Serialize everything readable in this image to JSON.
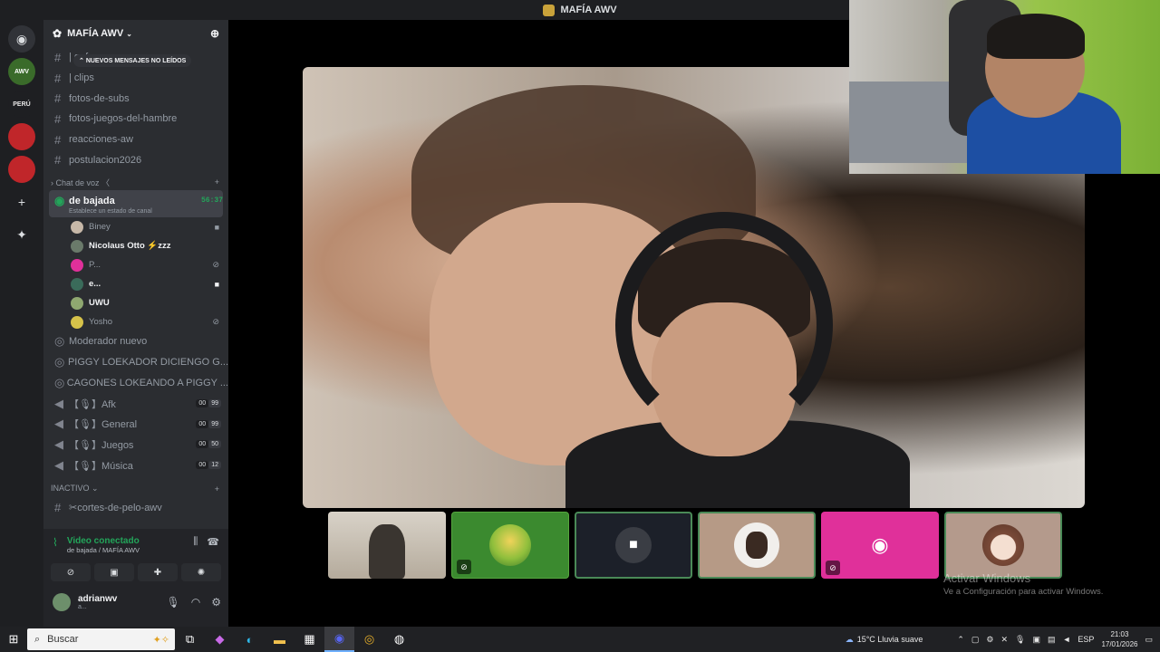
{
  "window": {
    "title": "MAFÍA AWV"
  },
  "rail": {
    "servers": [
      {
        "name": "discord-home",
        "icon": "discord-icon"
      },
      {
        "label": "AWV",
        "color": "#3a6b2a"
      },
      {
        "label": "PERÚ",
        "color": "#1e1f22"
      },
      {
        "label": "",
        "color": "#c0262a"
      },
      {
        "label": "",
        "color": "#c0262a"
      }
    ],
    "add_icon": "plus-icon",
    "explore_icon": "compass-icon"
  },
  "server": {
    "name": "MAFÍA AWV",
    "banner": "NUEVOS MENSAJES NO LEÍDOS"
  },
  "channels": {
    "text": [
      {
        "name": "| gafu"
      },
      {
        "name": "| clips"
      },
      {
        "name": "fotos-de-subs"
      },
      {
        "name": "fotos-juegos-del-hambre"
      },
      {
        "name": "reacciones-aw"
      },
      {
        "name": "postulacion2026"
      }
    ],
    "voice_category": "Chat de voz 〈",
    "active": {
      "name": "de bajada",
      "timer": "56:37",
      "status": "Establece un estado de canal"
    },
    "users": [
      {
        "name": "Biney",
        "color": "#c7b8a8",
        "icon": "camera-icon"
      },
      {
        "name": "Nicolaus Otto ⚡zzz",
        "color": "#6a7a6a",
        "bold": true,
        "icon": ""
      },
      {
        "name": "P...",
        "color": "#e0309a",
        "icon": "mic-muted-icon"
      },
      {
        "name": "e...",
        "color": "#3a6b5a",
        "bold": true,
        "icon": "camera-icon"
      },
      {
        "name": "UWU",
        "color": "#8fa870",
        "bold": true,
        "icon": ""
      },
      {
        "name": "Yosho",
        "color": "#d6c24a",
        "icon": "mic-muted-icon"
      }
    ],
    "stage_channels": [
      {
        "name": "Moderador nuevo"
      },
      {
        "name": "PIGGY LOEKADOR DICIENGO G..."
      },
      {
        "name": "CAGONES LOKEANDO A PIGGY ..."
      }
    ],
    "voice": [
      {
        "name": "【🎙】Afk",
        "a": "00",
        "b": "99"
      },
      {
        "name": "【🎙】General",
        "a": "00",
        "b": "99"
      },
      {
        "name": "【🎙】Juegos",
        "a": "00",
        "b": "50"
      },
      {
        "name": "【🎙】Música",
        "a": "00",
        "b": "12"
      }
    ],
    "inactive_category": "INACTIVO",
    "inactive": [
      {
        "name": "✂cortes-de-pelo-awv"
      }
    ]
  },
  "voice_panel": {
    "title": "Video conectado",
    "subtitle": "de bajada / MAFÍA AWV",
    "buttons": [
      "camera-off-icon",
      "screen-share-icon",
      "activities-icon",
      "soundboard-icon"
    ]
  },
  "user": {
    "name": "adrianwv",
    "status": "a..."
  },
  "activation": {
    "title": "Activar Windows",
    "subtitle": "Ve a Configuración para activar Windows."
  },
  "taskbar": {
    "search_placeholder": "Buscar",
    "weather": "15°C  Lluvia suave",
    "lang": "ESP",
    "time": "21:03",
    "date": "17/01/2026"
  }
}
